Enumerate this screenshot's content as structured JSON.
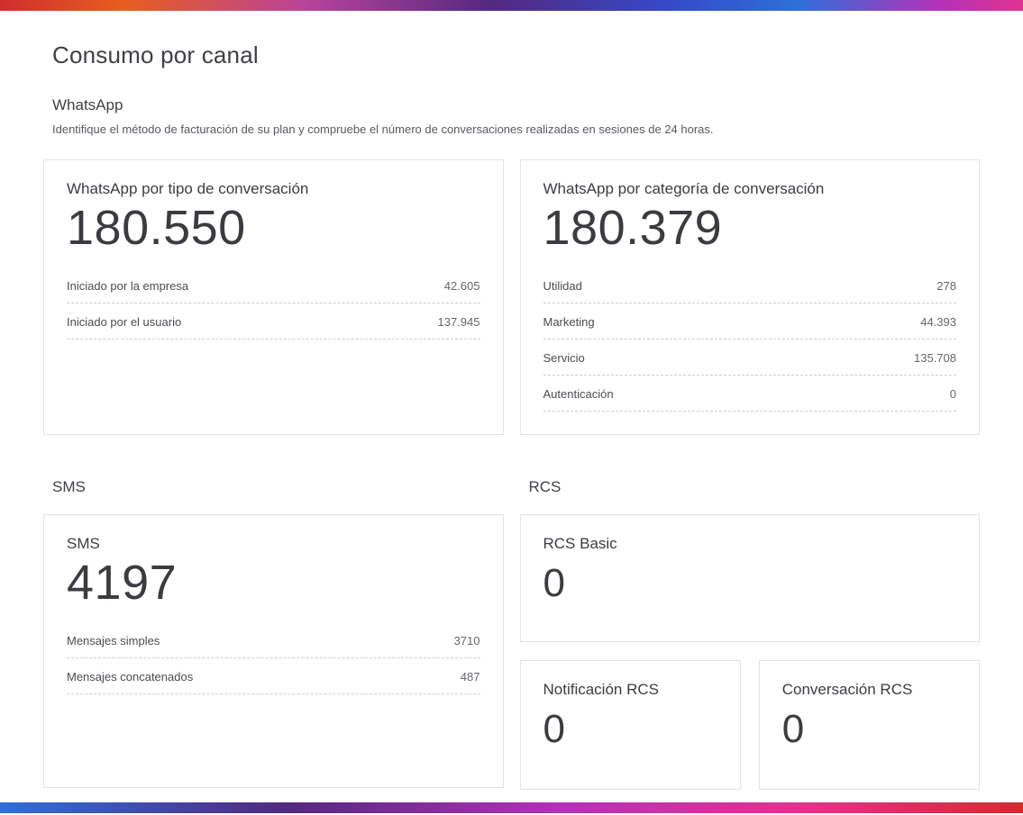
{
  "page": {
    "title": "Consumo por canal"
  },
  "brand": {
    "gradient_top": [
      "#cf2e2e",
      "#e85d1f",
      "#b8439b",
      "#53297f",
      "#3648c8",
      "#2f6fd9",
      "#b531b8",
      "#e0338f"
    ],
    "gradient_bottom": [
      "#2f6fd9",
      "#53297f",
      "#b531b8",
      "#e0338f",
      "#cf2e2e"
    ],
    "card_border": "#e3e3e6",
    "text_dark": "#3c3c42",
    "text_muted": "#66666c"
  },
  "sections": {
    "whatsapp": {
      "heading": "WhatsApp",
      "description": "Identifique el método de facturación de su plan y compruebe el número de conversaciones realizadas en sesiones de 24 horas.",
      "cards": [
        {
          "title": "WhatsApp por tipo de conversación",
          "total": "180.550",
          "rows": [
            {
              "label": "Iniciado por la empresa",
              "value": "42.605"
            },
            {
              "label": "Iniciado por el usuario",
              "value": "137.945"
            }
          ]
        },
        {
          "title": "WhatsApp por categoría de conversación",
          "total": "180.379",
          "rows": [
            {
              "label": "Utilidad",
              "value": "278"
            },
            {
              "label": "Marketing",
              "value": "44.393"
            },
            {
              "label": "Servicio",
              "value": "135.708"
            },
            {
              "label": "Autenticación",
              "value": "0"
            }
          ]
        }
      ]
    },
    "sms": {
      "heading": "SMS",
      "card": {
        "title": "SMS",
        "total": "4197",
        "rows": [
          {
            "label": "Mensajes simples",
            "value": "3710"
          },
          {
            "label": "Mensajes concatenados",
            "value": "487"
          }
        ]
      }
    },
    "rcs": {
      "heading": "RCS",
      "cards": [
        {
          "title": "RCS Basic",
          "total": "0"
        },
        {
          "title": "Notificación RCS",
          "total": "0"
        },
        {
          "title": "Conversación RCS",
          "total": "0"
        }
      ]
    }
  }
}
